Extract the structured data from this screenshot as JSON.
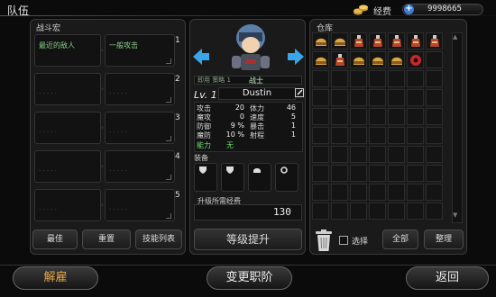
{
  "header": {
    "title": "队伍",
    "fee_label": "经费",
    "money": "9998665"
  },
  "left": {
    "label": "战斗宏",
    "rows": [
      {
        "num": "1",
        "condition": "最近的敌人",
        "action": "一般攻击"
      },
      {
        "num": "2",
        "condition": "",
        "action": ""
      },
      {
        "num": "3",
        "condition": "",
        "action": ""
      },
      {
        "num": "4",
        "condition": "",
        "action": ""
      },
      {
        "num": "5",
        "condition": "",
        "action": ""
      }
    ],
    "buttons": [
      "最佳",
      "重置",
      "技能列表"
    ]
  },
  "character": {
    "job_strip": "即用 策略 1",
    "job_badge": "战士",
    "level_label": "Lv. 1",
    "name": "Dustin",
    "stats_left": [
      {
        "label": "攻击",
        "value": "20"
      },
      {
        "label": "魔攻",
        "value": "0"
      },
      {
        "label": "防御",
        "value": "9 %"
      },
      {
        "label": "魔防",
        "value": "10 %"
      }
    ],
    "stats_right": [
      {
        "label": "体力",
        "value": "46"
      },
      {
        "label": "速度",
        "value": "5"
      },
      {
        "label": "暴击",
        "value": "1"
      },
      {
        "label": "射程",
        "value": "1"
      }
    ],
    "ability_label": "能力",
    "ability_value": "无",
    "equip_label": "装备",
    "upgrade_label": "升级所需经费",
    "upgrade_cost": "130",
    "level_up_button": "等级提升"
  },
  "inventory": {
    "label": "仓库",
    "select_label": "选择",
    "all_button": "全部",
    "sort_button": "整理",
    "items_row1": [
      "helmet-gold",
      "helmet-gold",
      "potion-red",
      "potion-red",
      "potion-red",
      "potion-red",
      "potion-red"
    ],
    "items_row2": [
      "helmet-gold",
      "potion-red",
      "helmet-gold",
      "helmet-gold",
      "helmet-gold",
      "gear-red"
    ]
  },
  "bottom": {
    "dismiss": "解雇",
    "change_job": "变更职阶",
    "back": "返回"
  },
  "colors": {
    "accent_green": "#6fdc6f",
    "dismiss_orange": "#e6a64a",
    "arrow_blue": "#3aa6e8"
  }
}
